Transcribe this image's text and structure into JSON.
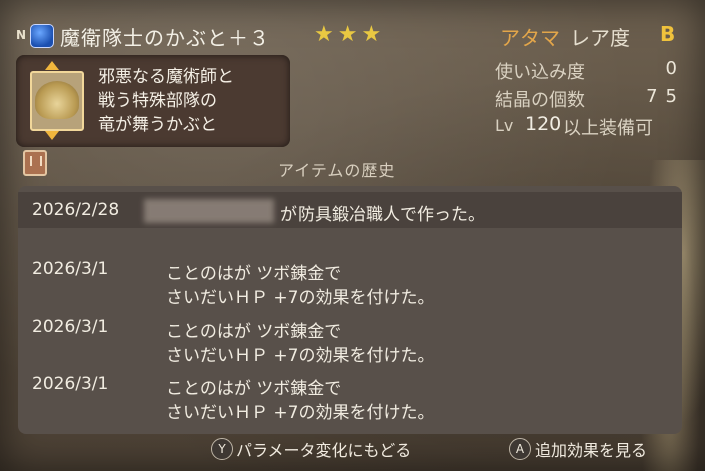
{
  "header": {
    "rarity_badge": "N",
    "item_name": "魔衛隊士のかぶと＋３",
    "stars": "★★★",
    "slot": "アタマ",
    "rarity_label": "レア度",
    "rarity_grade": "B"
  },
  "description": {
    "line1": "邪悪なる魔術師と",
    "line2": "戦う特殊部隊の",
    "line3": "竜が舞うかぶと"
  },
  "stats": {
    "usage_label": "使い込み度",
    "usage_value": "0",
    "crystal_label": "結晶の個数",
    "crystal_value": "75",
    "lv_label": "Lv",
    "lv_value": "120",
    "lv_suffix": "以上装備可"
  },
  "history": {
    "title": "アイテムの歴史",
    "entries": [
      {
        "date": "2026/2/28",
        "by": "が",
        "text": "防具鍛冶職人で作った。"
      },
      {
        "date": "2026/3/1",
        "line1": "ことのはが ツボ錬金で",
        "line2": "さいだいＨＰ +7の効果を付けた。"
      },
      {
        "date": "2026/3/1",
        "line1": "ことのはが ツボ錬金で",
        "line2": "さいだいＨＰ +7の効果を付けた。"
      },
      {
        "date": "2026/3/1",
        "line1": "ことのはが ツボ錬金で",
        "line2": "さいだいＨＰ +7の効果を付けた。"
      }
    ]
  },
  "footer": {
    "y_button": "Y",
    "y_action": "パラメータ変化にもどる",
    "a_button": "A",
    "a_action": "追加効果を見る"
  },
  "colors": {
    "slot": "#e3a64a",
    "stars": "#e9c842",
    "grade": "#f0c23c"
  },
  "icons": [
    "helmet-icon",
    "arrow-up-icon",
    "arrow-down-icon",
    "book-icon"
  ]
}
